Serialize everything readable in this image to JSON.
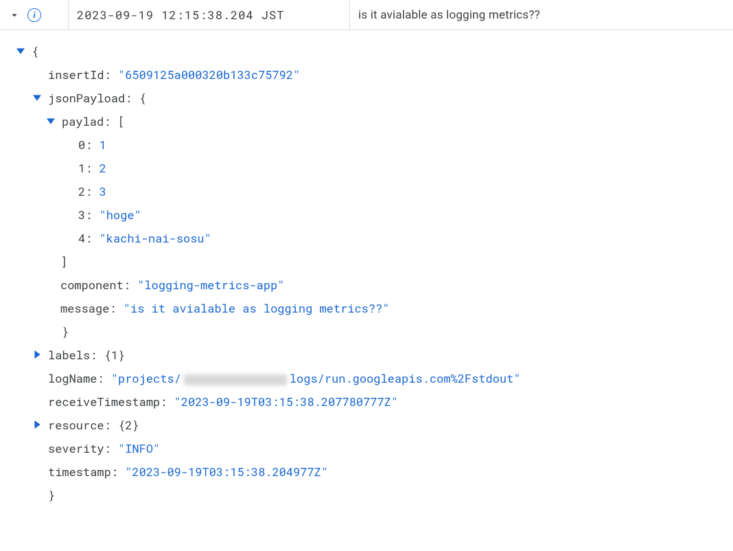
{
  "header": {
    "timestamp": "2023-09-19 12:15:38.204 JST",
    "summary": "is it avialable as logging metrics??"
  },
  "log": {
    "insertId_key": "insertId",
    "insertId_val": "\"6509125a000320b133c75792\"",
    "jsonPayload_key": "jsonPayload",
    "open_brace": "{",
    "close_brace": "}",
    "open_bracket": "[",
    "close_bracket": "]",
    "paylad_key": "paylad",
    "paylad_items": {
      "i0_key": "0",
      "i0_val": "1",
      "i1_key": "1",
      "i1_val": "2",
      "i2_key": "2",
      "i2_val": "3",
      "i3_key": "3",
      "i3_val": "\"hoge\"",
      "i4_key": "4",
      "i4_val": "\"kachi-nai-sosu\""
    },
    "component_key": "component",
    "component_val": "\"logging-metrics-app\"",
    "message_key": "message",
    "message_val": "\"is it avialable as logging metrics??\"",
    "labels_key": "labels",
    "labels_summary": "{1}",
    "logName_key": "logName",
    "logName_prefix": "\"projects/",
    "logName_suffix": "logs/run.googleapis.com%2Fstdout\"",
    "receiveTimestamp_key": "receiveTimestamp",
    "receiveTimestamp_val": "\"2023-09-19T03:15:38.207780777Z\"",
    "resource_key": "resource",
    "resource_summary": "{2}",
    "severity_key": "severity",
    "severity_val": "\"INFO\"",
    "timestamp_key": "timestamp",
    "timestamp_val": "\"2023-09-19T03:15:38.204977Z\""
  }
}
